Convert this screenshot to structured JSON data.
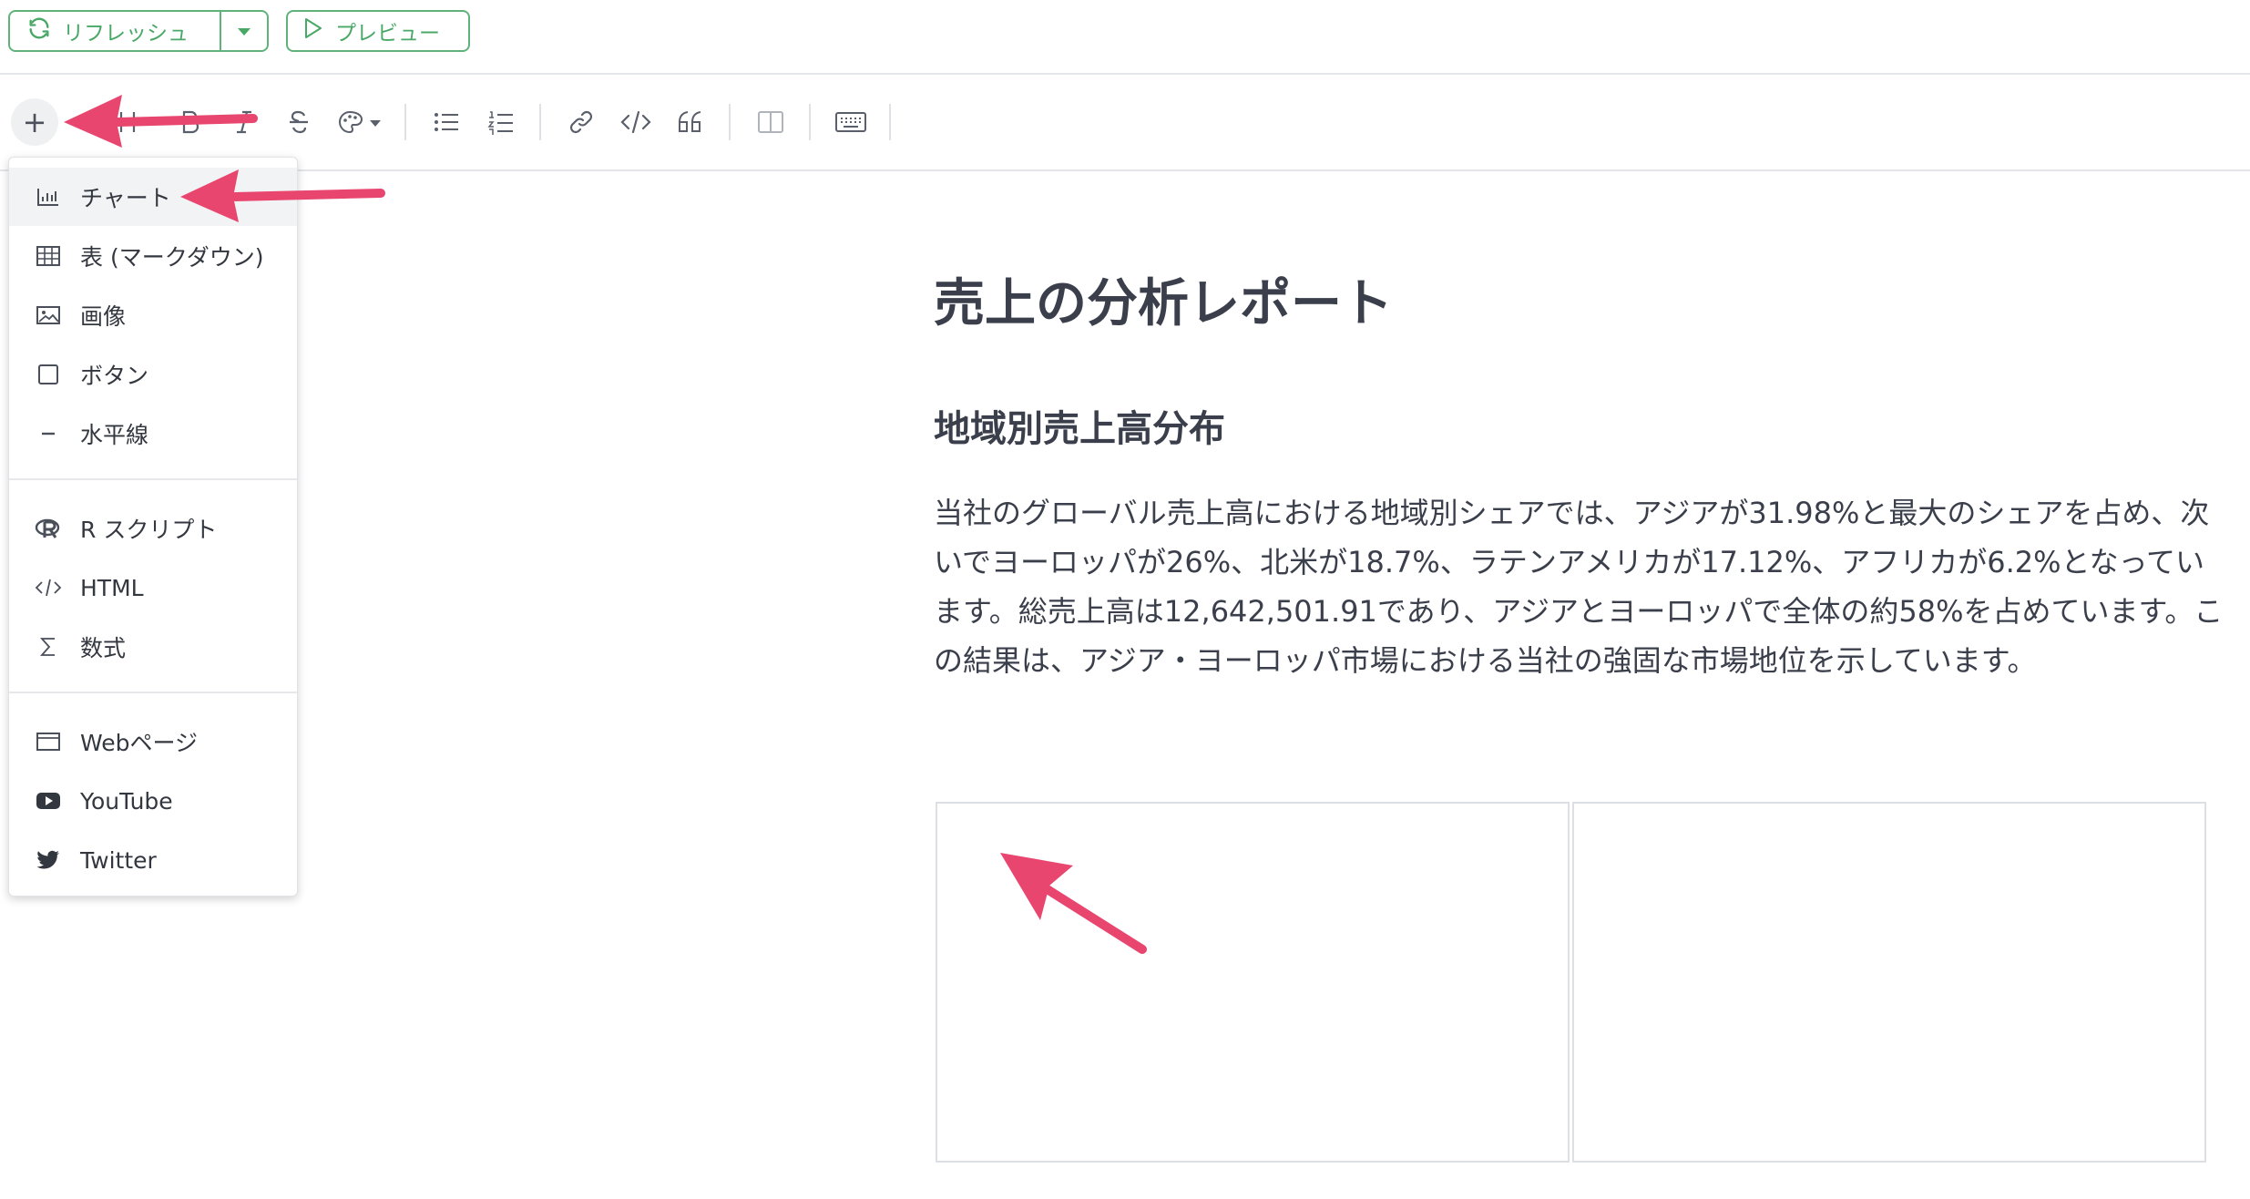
{
  "header": {
    "refresh_label": "リフレッシュ",
    "preview_label": "プレビュー",
    "accent_color": "#4aa867"
  },
  "toolbar": {
    "icons": [
      "plus-icon",
      "heading-icon",
      "bold-icon",
      "italic-icon",
      "strikethrough-icon",
      "palette-icon",
      "bullet-list-icon",
      "numbered-list-icon",
      "link-icon",
      "code-icon",
      "quote-icon",
      "split-view-icon",
      "keyboard-icon"
    ]
  },
  "insert_menu": {
    "items": [
      {
        "label": "チャート",
        "icon": "chart-icon"
      },
      {
        "label": "表 (マークダウン)",
        "icon": "table-icon"
      },
      {
        "label": "画像",
        "icon": "image-icon"
      },
      {
        "label": "ボタン",
        "icon": "button-icon"
      },
      {
        "label": "水平線",
        "icon": "horizontal-line-icon"
      },
      {
        "label": "R スクリプト",
        "icon": "r-icon"
      },
      {
        "label": "HTML",
        "icon": "html-icon"
      },
      {
        "label": "数式",
        "icon": "sigma-icon"
      },
      {
        "label": "Webページ",
        "icon": "browser-icon"
      },
      {
        "label": "YouTube",
        "icon": "youtube-icon"
      },
      {
        "label": "Twitter",
        "icon": "twitter-icon"
      }
    ]
  },
  "document": {
    "title": "売上の分析レポート",
    "subtitle": "地域別売上高分布",
    "paragraph": "当社のグローバル売上高における地域別シェアでは、アジアが31.98%と最大のシェアを占め、次いでヨーロッパが26%、北米が18.7%、ラテンアメリカが17.12%、アフリカが6.2%となっています。総売上高は12,642,501.91であり、アジアとヨーロッパで全体の約58%を占めています。この結果は、アジア・ヨーロッパ市場における当社の強固な市場地位を示しています。"
  },
  "annotation": {
    "arrow_color": "#e8466f"
  }
}
